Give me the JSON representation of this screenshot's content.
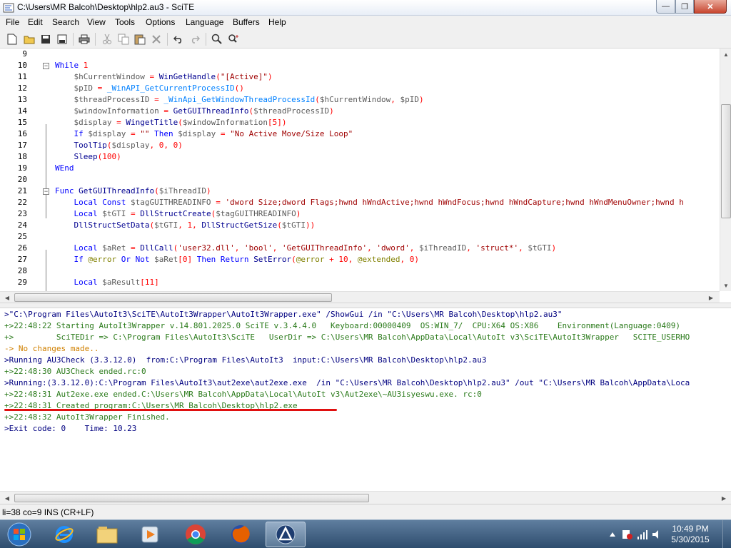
{
  "window": {
    "title": "C:\\Users\\MR Balcoh\\Desktop\\hlp2.au3 - SciTE"
  },
  "menu": [
    "File",
    "Edit",
    "Search",
    "View",
    "Tools",
    "Options",
    "Language",
    "Buffers",
    "Help"
  ],
  "toolbar": {
    "icons": [
      "new-file-icon",
      "open-folder-icon",
      "save-icon",
      "save-as-icon",
      "print-icon",
      "cut-icon",
      "copy-icon",
      "paste-icon",
      "delete-icon",
      "undo-icon",
      "redo-icon",
      "find-icon",
      "replace-icon"
    ]
  },
  "editor": {
    "line_numbers": [
      "9",
      "10",
      "11",
      "12",
      "13",
      "14",
      "15",
      "16",
      "17",
      "18",
      "19",
      "20",
      "21",
      "22",
      "23",
      "24",
      "25",
      "26",
      "27",
      "28",
      "29"
    ],
    "lines": [
      [],
      [
        [
          "kw",
          "While "
        ],
        [
          "num",
          "1"
        ]
      ],
      [
        [
          "var",
          "    $hCurrentWindow "
        ],
        [
          "op",
          "= "
        ],
        [
          "fn",
          "WinGetHandle"
        ],
        [
          "op",
          "("
        ],
        [
          "str",
          "\"[Active]\""
        ],
        [
          "op",
          ")"
        ]
      ],
      [
        [
          "var",
          "    $pID "
        ],
        [
          "op",
          "= "
        ],
        [
          "bi",
          "_WinAPI_GetCurrentProcessID"
        ],
        [
          "op",
          "()"
        ]
      ],
      [
        [
          "var",
          "    $threadProcessID "
        ],
        [
          "op",
          "= "
        ],
        [
          "bi",
          "_WinApi_GetWindowThreadProcessId"
        ],
        [
          "op",
          "("
        ],
        [
          "var",
          "$hCurrentWindow"
        ],
        [
          "op",
          ", "
        ],
        [
          "var",
          "$pID"
        ],
        [
          "op",
          ")"
        ]
      ],
      [
        [
          "var",
          "    $windowInformation "
        ],
        [
          "op",
          "= "
        ],
        [
          "fn",
          "GetGUIThreadInfo"
        ],
        [
          "op",
          "("
        ],
        [
          "var",
          "$threadProcessID"
        ],
        [
          "op",
          ")"
        ]
      ],
      [
        [
          "var",
          "    $display "
        ],
        [
          "op",
          "= "
        ],
        [
          "fn",
          "WingetTitle"
        ],
        [
          "op",
          "("
        ],
        [
          "var",
          "$windowInformation"
        ],
        [
          "op",
          "["
        ],
        [
          "num",
          "5"
        ],
        [
          "op",
          "])"
        ]
      ],
      [
        [
          "kw",
          "    If "
        ],
        [
          "var",
          "$display "
        ],
        [
          "op",
          "= "
        ],
        [
          "str",
          "\"\" "
        ],
        [
          "kw",
          "Then "
        ],
        [
          "var",
          "$display "
        ],
        [
          "op",
          "= "
        ],
        [
          "str",
          "\"No Active Move/Size Loop\""
        ]
      ],
      [
        [
          "fn",
          "    ToolTip"
        ],
        [
          "op",
          "("
        ],
        [
          "var",
          "$display"
        ],
        [
          "op",
          ", "
        ],
        [
          "num",
          "0"
        ],
        [
          "op",
          ", "
        ],
        [
          "num",
          "0"
        ],
        [
          "op",
          ")"
        ]
      ],
      [
        [
          "fn",
          "    Sleep"
        ],
        [
          "op",
          "("
        ],
        [
          "num",
          "100"
        ],
        [
          "op",
          ")"
        ]
      ],
      [
        [
          "kw",
          "WEnd"
        ]
      ],
      [],
      [
        [
          "kw",
          "Func "
        ],
        [
          "fn",
          "GetGUIThreadInfo"
        ],
        [
          "op",
          "("
        ],
        [
          "var",
          "$iThreadID"
        ],
        [
          "op",
          ")"
        ]
      ],
      [
        [
          "kw",
          "    Local Const "
        ],
        [
          "var",
          "$tagGUITHREADINFO "
        ],
        [
          "op",
          "= "
        ],
        [
          "str",
          "'dword Size;dword Flags;hwnd hWndActive;hwnd hWndFocus;hwnd hWndCapture;hwnd hWndMenuOwner;hwnd h"
        ]
      ],
      [
        [
          "kw",
          "    Local "
        ],
        [
          "var",
          "$tGTI "
        ],
        [
          "op",
          "= "
        ],
        [
          "fn",
          "DllStructCreate"
        ],
        [
          "op",
          "("
        ],
        [
          "var",
          "$tagGUITHREADINFO"
        ],
        [
          "op",
          ")"
        ]
      ],
      [
        [
          "fn",
          "    DllStructSetData"
        ],
        [
          "op",
          "("
        ],
        [
          "var",
          "$tGTI"
        ],
        [
          "op",
          ", "
        ],
        [
          "num",
          "1"
        ],
        [
          "op",
          ", "
        ],
        [
          "fn",
          "DllStructGetSize"
        ],
        [
          "op",
          "("
        ],
        [
          "var",
          "$tGTI"
        ],
        [
          "op",
          "))"
        ]
      ],
      [],
      [
        [
          "kw",
          "    Local "
        ],
        [
          "var",
          "$aRet "
        ],
        [
          "op",
          "= "
        ],
        [
          "fn",
          "DllCall"
        ],
        [
          "op",
          "("
        ],
        [
          "str",
          "'user32.dll'"
        ],
        [
          "op",
          ", "
        ],
        [
          "str",
          "'bool'"
        ],
        [
          "op",
          ", "
        ],
        [
          "str",
          "'GetGUIThreadInfo'"
        ],
        [
          "op",
          ", "
        ],
        [
          "str",
          "'dword'"
        ],
        [
          "op",
          ", "
        ],
        [
          "var",
          "$iThreadID"
        ],
        [
          "op",
          ", "
        ],
        [
          "str",
          "'struct*'"
        ],
        [
          "op",
          ", "
        ],
        [
          "var",
          "$tGTI"
        ],
        [
          "op",
          ")"
        ]
      ],
      [
        [
          "kw",
          "    If "
        ],
        [
          "mac",
          "@error "
        ],
        [
          "kw",
          "Or Not "
        ],
        [
          "var",
          "$aRet"
        ],
        [
          "op",
          "["
        ],
        [
          "num",
          "0"
        ],
        [
          "op",
          "] "
        ],
        [
          "kw",
          "Then Return "
        ],
        [
          "fn",
          "SetError"
        ],
        [
          "op",
          "("
        ],
        [
          "mac",
          "@error "
        ],
        [
          "op",
          "+ "
        ],
        [
          "num",
          "10"
        ],
        [
          "op",
          ", "
        ],
        [
          "mac",
          "@extended"
        ],
        [
          "op",
          ", "
        ],
        [
          "num",
          "0"
        ],
        [
          "op",
          ")"
        ]
      ],
      [],
      [
        [
          "kw",
          "    Local "
        ],
        [
          "var",
          "$aResult"
        ],
        [
          "op",
          "["
        ],
        [
          "num",
          "11"
        ],
        [
          "op",
          "]"
        ]
      ]
    ]
  },
  "output": {
    "lines": [
      {
        "cls": "o-cmd",
        "text": ">\"C:\\Program Files\\AutoIt3\\SciTE\\AutoIt3Wrapper\\AutoIt3Wrapper.exe\" /ShowGui /in \"C:\\Users\\MR Balcoh\\Desktop\\hlp2.au3\""
      },
      {
        "cls": "o-plus",
        "text": "+>22:48:22 Starting AutoIt3Wrapper v.14.801.2025.0 SciTE v.3.4.4.0   Keyboard:00000409  OS:WIN_7/  CPU:X64 OS:X86    Environment(Language:0409)"
      },
      {
        "cls": "o-plus",
        "text": "+>         SciTEDir => C:\\Program Files\\AutoIt3\\SciTE   UserDir => C:\\Users\\MR Balcoh\\AppData\\Local\\AutoIt v3\\SciTE\\AutoIt3Wrapper   SCITE_USERHO"
      },
      {
        "cls": "o-warn",
        "text": "-> No changes made.."
      },
      {
        "cls": "o-cmd",
        "text": ">Running AU3Check (3.3.12.0)  from:C:\\Program Files\\AutoIt3  input:C:\\Users\\MR Balcoh\\Desktop\\hlp2.au3"
      },
      {
        "cls": "o-plus",
        "text": "+>22:48:30 AU3Check ended.rc:0"
      },
      {
        "cls": "o-cmd",
        "text": ">Running:(3.3.12.0):C:\\Program Files\\AutoIt3\\aut2exe\\aut2exe.exe  /in \"C:\\Users\\MR Balcoh\\Desktop\\hlp2.au3\" /out \"C:\\Users\\MR Balcoh\\AppData\\Loca"
      },
      {
        "cls": "o-plus",
        "text": "+>22:48:31 Aut2exe.exe ended.C:\\Users\\MR Balcoh\\AppData\\Local\\AutoIt v3\\Aut2exe\\~AU3isyeswu.exe. rc:0"
      },
      {
        "cls": "o-plus",
        "text": "+>22:48:31 Created program:C:\\Users\\MR Balcoh\\Desktop\\hlp2.exe"
      },
      {
        "cls": "o-plus",
        "text": "+>22:48:32 AutoIt3Wrapper Finished."
      },
      {
        "cls": "o-cmd",
        "text": ">Exit code: 0    Time: 10.23"
      }
    ]
  },
  "status": {
    "text": "li=38 co=9 INS (CR+LF)"
  },
  "taskbar": {
    "apps": [
      "start-orb",
      "internet-explorer-icon",
      "file-explorer-icon",
      "media-player-icon",
      "chrome-icon",
      "firefox-icon",
      "autoit-scite-icon"
    ],
    "clock_time": "10:49 PM",
    "clock_date": "5/30/2015"
  },
  "colors": {
    "accent_underline": "#e01010",
    "output_green": "#2a7a1a",
    "keyword_blue": "#0000ff"
  }
}
